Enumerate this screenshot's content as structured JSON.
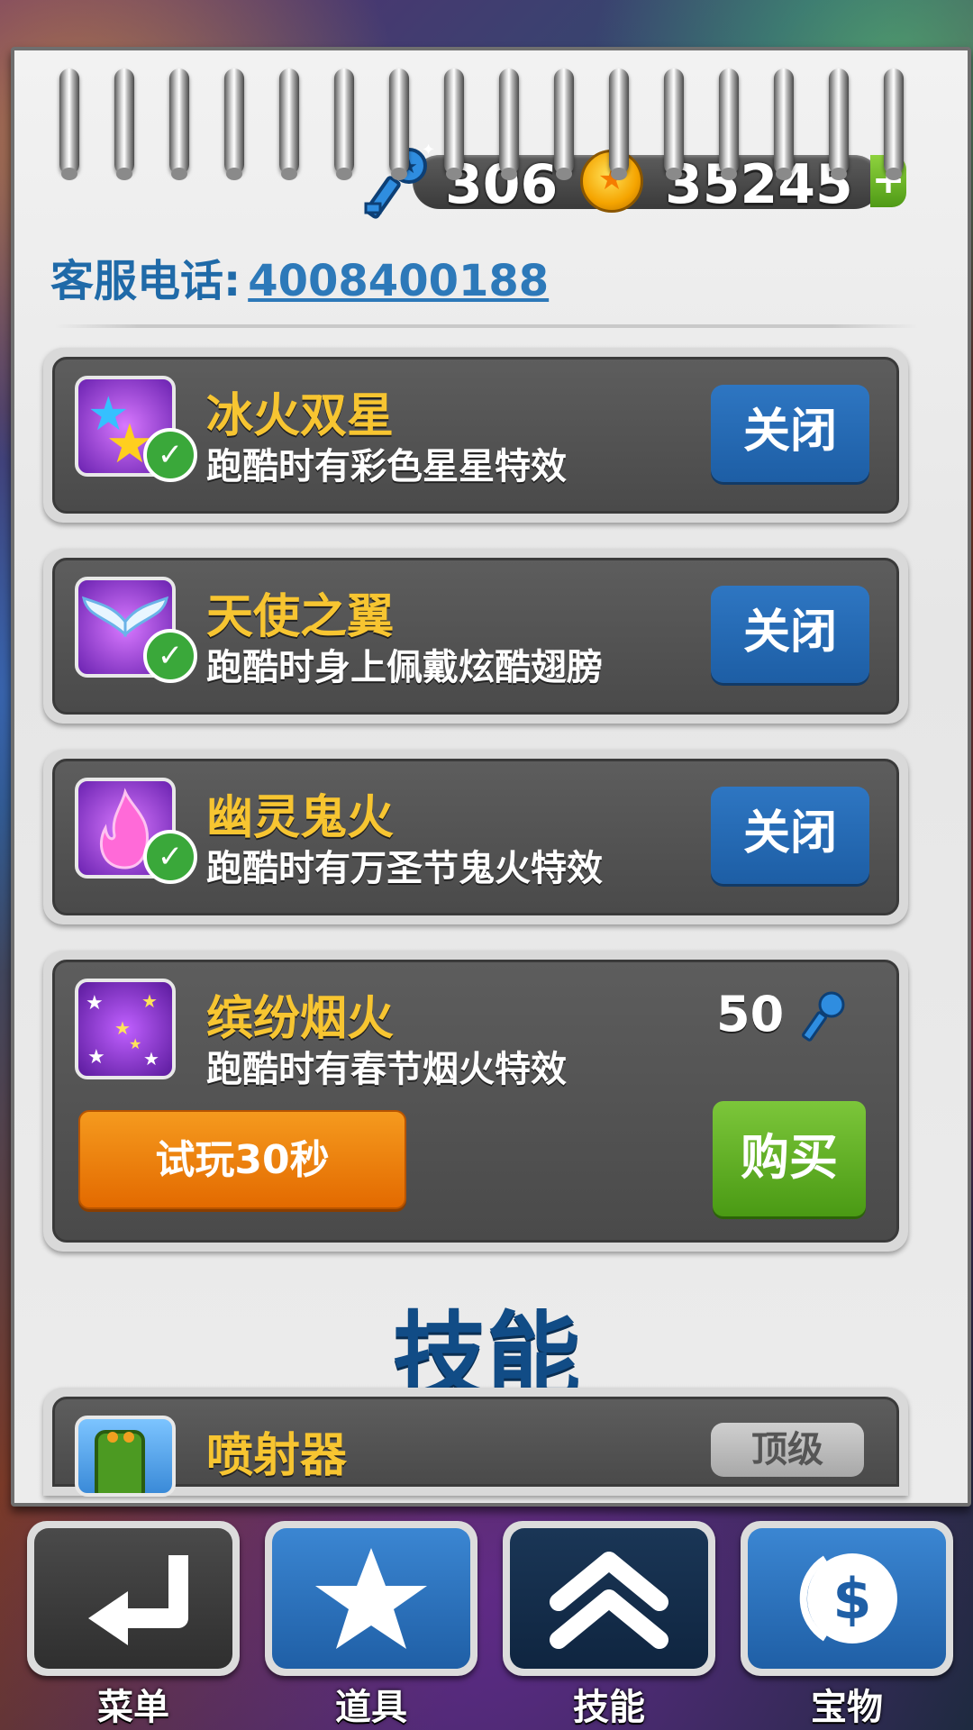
{
  "currency": {
    "keys": "306",
    "coins": "35245",
    "add_label": "+"
  },
  "hotline": {
    "label": "客服电话:",
    "number": "4008400188"
  },
  "effects": [
    {
      "name": "冰火双星",
      "description": "跑酷时有彩色星星特效",
      "action": "关闭",
      "owned": true,
      "icon": "stars-icon"
    },
    {
      "name": "天使之翼",
      "description": "跑酷时身上佩戴炫酷翅膀",
      "action": "关闭",
      "owned": true,
      "icon": "wings-icon"
    },
    {
      "name": "幽灵鬼火",
      "description": "跑酷时有万圣节鬼火特效",
      "action": "关闭",
      "owned": true,
      "icon": "ghost-fire-icon"
    },
    {
      "name": "缤纷烟火",
      "description": "跑酷时有春节烟火特效",
      "price": "50",
      "trial": "试玩30秒",
      "buy": "购买",
      "owned": false,
      "icon": "fireworks-icon"
    }
  ],
  "skills": {
    "title": "技能",
    "items": [
      {
        "name": "喷射器",
        "level": "顶级",
        "icon": "jetpack-icon"
      }
    ]
  },
  "nav": [
    {
      "label": "菜单",
      "icon": "return-icon"
    },
    {
      "label": "道具",
      "icon": "star-icon"
    },
    {
      "label": "技能",
      "icon": "chevron-up-icon"
    },
    {
      "label": "宝物",
      "icon": "dollar-icon"
    }
  ],
  "colors": {
    "title_gold": "#f7c531",
    "close_blue": "#2e76c2",
    "buy_green": "#5aa81e",
    "trial_orange": "#f08a10",
    "heading_blue": "#114c86"
  }
}
